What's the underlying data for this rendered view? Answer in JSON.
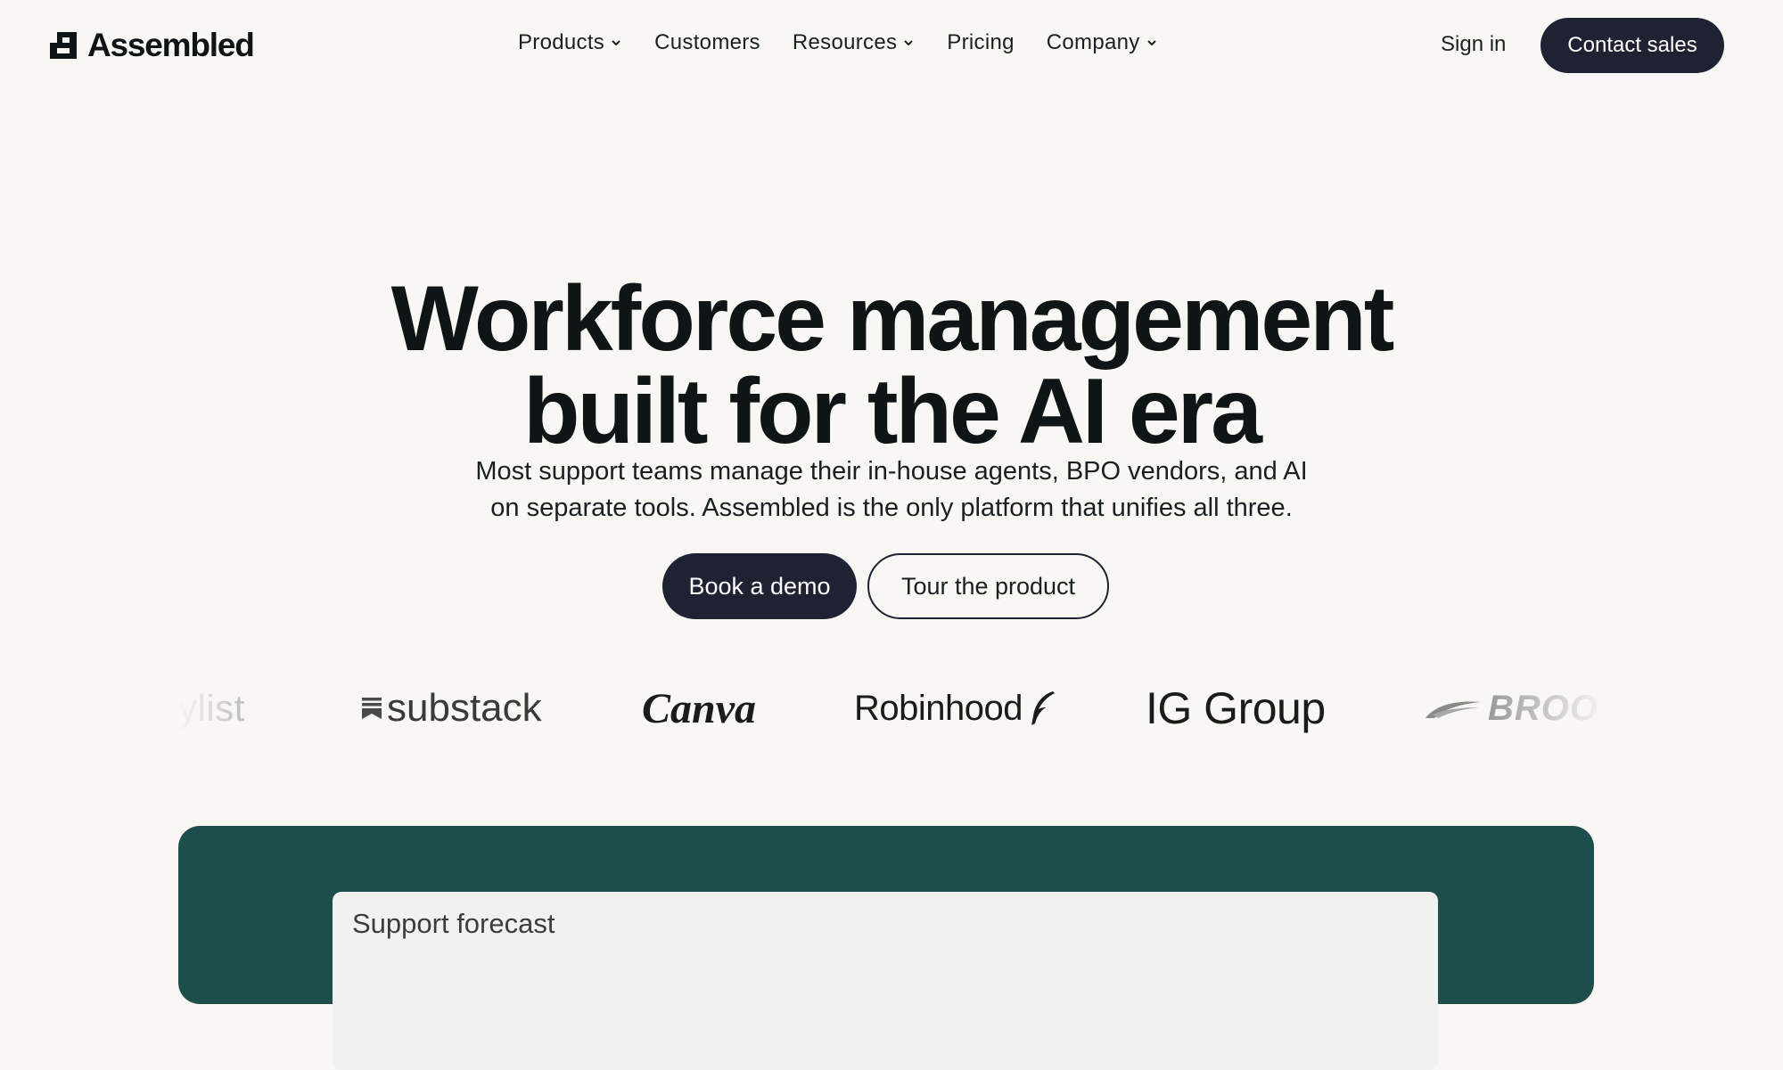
{
  "brand": {
    "name": "Assembled"
  },
  "nav": {
    "items": [
      {
        "label": "Products",
        "has_dropdown": true
      },
      {
        "label": "Customers",
        "has_dropdown": false
      },
      {
        "label": "Resources",
        "has_dropdown": true
      },
      {
        "label": "Pricing",
        "has_dropdown": false
      },
      {
        "label": "Company",
        "has_dropdown": true
      }
    ],
    "sign_in": "Sign in",
    "contact": "Contact sales"
  },
  "hero": {
    "headline_lines": [
      "Workforce management",
      "built for the AI era"
    ],
    "subtitle_lines": [
      "Most support teams manage their in-house agents, BPO vendors, and AI",
      "on separate tools. Assembled is the only platform that unifies all three."
    ],
    "primary_cta": "Book a demo",
    "secondary_cta": "Tour the product"
  },
  "logos": {
    "stylist": "ylist",
    "substack": "substack",
    "canva": "Canva",
    "robinhood": "Robinhood",
    "ig": "IG Group",
    "brooks": "BROO"
  },
  "preview": {
    "card_title": "Support forecast"
  },
  "colors": {
    "background": "#f8f7f4",
    "dark_button": "#1f2233",
    "panel": "#1e4e4c",
    "text": "#0f1416"
  }
}
